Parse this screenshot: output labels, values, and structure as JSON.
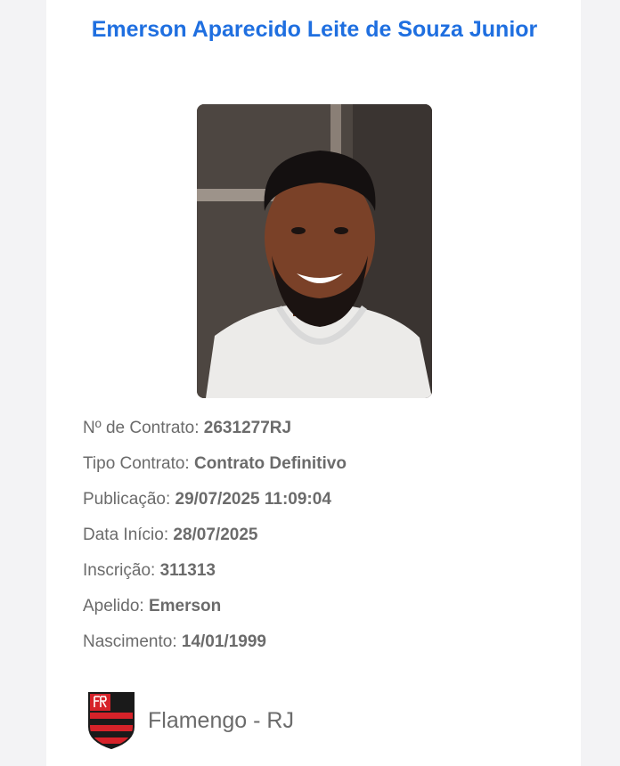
{
  "player": {
    "name": "Emerson Aparecido Leite de Souza Junior",
    "photo_alt": "player-photo"
  },
  "details": [
    {
      "label": "Nº de Contrato:",
      "value": "2631277RJ"
    },
    {
      "label": "Tipo Contrato:",
      "value": "Contrato Definitivo"
    },
    {
      "label": "Publicação:",
      "value": "29/07/2025 11:09:04"
    },
    {
      "label": "Data Início:",
      "value": "28/07/2025"
    },
    {
      "label": "Inscrição:",
      "value": "311313"
    },
    {
      "label": "Apelido:",
      "value": "Emerson"
    },
    {
      "label": "Nascimento:",
      "value": "14/01/1999"
    }
  ],
  "club": {
    "name": "Flamengo - RJ",
    "crest_icon": "flamengo-crest-icon",
    "colors": {
      "red": "#d62229",
      "black": "#1a1a1a"
    }
  },
  "theme": {
    "title_color": "#1f6fe0",
    "text_color": "#6b6b6b"
  }
}
